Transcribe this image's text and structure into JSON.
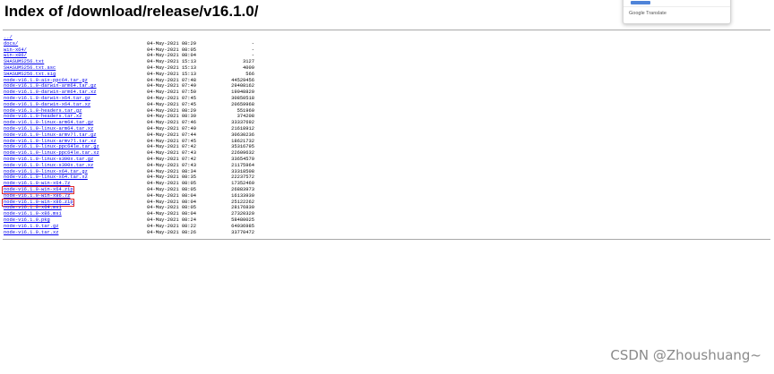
{
  "page": {
    "title": "Index of /download/release/v16.1.0/"
  },
  "translate_popup": {
    "label": "Google Translate"
  },
  "watermark": "CSDN @Zhoushuang~",
  "colors": {
    "link": "#0000ee",
    "highlight_box": "#e0262a",
    "rule": "#a8a8a8",
    "watermark": "#8a8a8a"
  },
  "files": [
    {
      "name": "../",
      "date": "",
      "size": "",
      "highlighted": false
    },
    {
      "name": "docs/",
      "date": "04-May-2021 08:29",
      "size": "-",
      "highlighted": false
    },
    {
      "name": "win-x64/",
      "date": "04-May-2021 08:05",
      "size": "-",
      "highlighted": false
    },
    {
      "name": "win-x86/",
      "date": "04-May-2021 08:04",
      "size": "-",
      "highlighted": false
    },
    {
      "name": "SHASUMS256.txt",
      "date": "04-May-2021 15:13",
      "size": "3127",
      "highlighted": false
    },
    {
      "name": "SHASUMS256.txt.asc",
      "date": "04-May-2021 15:13",
      "size": "4009",
      "highlighted": false
    },
    {
      "name": "SHASUMS256.txt.sig",
      "date": "04-May-2021 15:13",
      "size": "566",
      "highlighted": false
    },
    {
      "name": "node-v16.1.0-aix-ppc64.tar.gz",
      "date": "04-May-2021 07:48",
      "size": "44529456",
      "highlighted": false
    },
    {
      "name": "node-v16.1.0-darwin-arm64.tar.gz",
      "date": "04-May-2021 07:49",
      "size": "29408162",
      "highlighted": false
    },
    {
      "name": "node-v16.1.0-darwin-arm64.tar.xz",
      "date": "04-May-2021 07:50",
      "size": "19048820",
      "highlighted": false
    },
    {
      "name": "node-v16.1.0-darwin-x64.tar.gz",
      "date": "04-May-2021 07:45",
      "size": "30850518",
      "highlighted": false
    },
    {
      "name": "node-v16.1.0-darwin-x64.tar.xz",
      "date": "04-May-2021 07:45",
      "size": "20659968",
      "highlighted": false
    },
    {
      "name": "node-v16.1.0-headers.tar.gz",
      "date": "04-May-2021 08:29",
      "size": "551960",
      "highlighted": false
    },
    {
      "name": "node-v16.1.0-headers.tar.xz",
      "date": "04-May-2021 08:30",
      "size": "374208",
      "highlighted": false
    },
    {
      "name": "node-v16.1.0-linux-arm64.tar.gz",
      "date": "04-May-2021 07:46",
      "size": "33337692",
      "highlighted": false
    },
    {
      "name": "node-v16.1.0-linux-arm64.tar.xz",
      "date": "04-May-2021 07:49",
      "size": "21618912",
      "highlighted": false
    },
    {
      "name": "node-v16.1.0-linux-armv7l.tar.gz",
      "date": "04-May-2021 07:44",
      "size": "30630236",
      "highlighted": false
    },
    {
      "name": "node-v16.1.0-linux-armv7l.tar.xz",
      "date": "04-May-2021 07:45",
      "size": "18621732",
      "highlighted": false
    },
    {
      "name": "node-v16.1.0-linux-ppc64le.tar.gz",
      "date": "04-May-2021 07:42",
      "size": "35316795",
      "highlighted": false
    },
    {
      "name": "node-v16.1.0-linux-ppc64le.tar.xz",
      "date": "04-May-2021 07:43",
      "size": "22609632",
      "highlighted": false
    },
    {
      "name": "node-v16.1.0-linux-s390x.tar.gz",
      "date": "04-May-2021 07:42",
      "size": "33654570",
      "highlighted": false
    },
    {
      "name": "node-v16.1.0-linux-s390x.tar.xz",
      "date": "04-May-2021 07:43",
      "size": "21175964",
      "highlighted": false
    },
    {
      "name": "node-v16.1.0-linux-x64.tar.gz",
      "date": "04-May-2021 08:34",
      "size": "33318508",
      "highlighted": false
    },
    {
      "name": "node-v16.1.0-linux-x64.tar.xz",
      "date": "04-May-2021 08:35",
      "size": "22237572",
      "highlighted": false
    },
    {
      "name": "node-v16.1.0-win-x64.7z",
      "date": "04-May-2021 08:05",
      "size": "17352460",
      "highlighted": false
    },
    {
      "name": "node-v16.1.0-win-x64.zip",
      "date": "04-May-2021 08:05",
      "size": "26883973",
      "highlighted": true
    },
    {
      "name": "node-v16.1.0-win-x86.7z",
      "date": "04-May-2021 08:04",
      "size": "16133930",
      "highlighted": false
    },
    {
      "name": "node-v16.1.0-win-x86.zip",
      "date": "04-May-2021 08:04",
      "size": "25122262",
      "highlighted": true
    },
    {
      "name": "node-v16.1.0-x64.msi",
      "date": "04-May-2021 08:05",
      "size": "28176830",
      "highlighted": false
    },
    {
      "name": "node-v16.1.0-x86.msi",
      "date": "04-May-2021 08:04",
      "size": "27320320",
      "highlighted": false
    },
    {
      "name": "node-v16.1.0.pkg",
      "date": "04-May-2021 08:24",
      "size": "58480025",
      "highlighted": false
    },
    {
      "name": "node-v16.1.0.tar.gz",
      "date": "04-May-2021 08:22",
      "size": "64036985",
      "highlighted": false
    },
    {
      "name": "node-v16.1.0.tar.xz",
      "date": "04-May-2021 08:26",
      "size": "33770472",
      "highlighted": false
    }
  ]
}
